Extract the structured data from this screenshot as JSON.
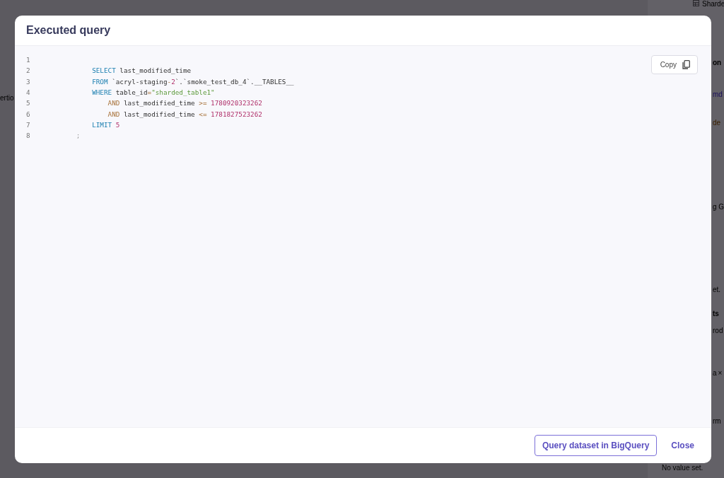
{
  "background_page": {
    "fragments": [
      {
        "kind": "table-link",
        "text": "Sharde"
      },
      {
        "kind": "heading",
        "text": "on"
      },
      {
        "kind": "link",
        "text": "md"
      },
      {
        "kind": "warning",
        "text": "de"
      },
      {
        "kind": "plain",
        "text": "g G"
      },
      {
        "kind": "muted",
        "text": "et."
      },
      {
        "kind": "heading",
        "text": "ts"
      },
      {
        "kind": "plain",
        "text": "rod"
      },
      {
        "kind": "tag",
        "text": "a",
        "close": "×"
      },
      {
        "kind": "plain",
        "text": "rm"
      },
      {
        "kind": "muted",
        "text": "No value set."
      },
      {
        "kind": "tab",
        "text": "ertio"
      }
    ]
  },
  "modal": {
    "title": "Executed query",
    "copy_button": "Copy",
    "code_lines": [
      {
        "number": "1"
      },
      {
        "number": "2",
        "tokens": [
          {
            "kind": "keyword",
            "text": "            SELECT"
          },
          {
            "kind": "plain",
            "text": " last_modified_time"
          }
        ]
      },
      {
        "number": "3",
        "tokens": [
          {
            "kind": "keyword",
            "text": "            FROM"
          },
          {
            "kind": "plain",
            "text": " `acryl-staging"
          },
          {
            "kind": "operator",
            "text": "-"
          },
          {
            "kind": "number",
            "text": "2"
          },
          {
            "kind": "plain",
            "text": "`.`smoke_test_db_4`.__TABLES__"
          }
        ]
      },
      {
        "number": "4",
        "tokens": [
          {
            "kind": "keyword",
            "text": "            WHERE"
          },
          {
            "kind": "plain",
            "text": " table_id"
          },
          {
            "kind": "operator",
            "text": "="
          },
          {
            "kind": "string",
            "text": "\"sharded_table1\""
          }
        ]
      },
      {
        "number": "5",
        "tokens": [
          {
            "kind": "operator",
            "text": "                AND"
          },
          {
            "kind": "plain",
            "text": " last_modified_time "
          },
          {
            "kind": "operator",
            "text": ">="
          },
          {
            "kind": "number",
            "text": " 1780920323262"
          }
        ]
      },
      {
        "number": "6",
        "tokens": [
          {
            "kind": "operator",
            "text": "                AND"
          },
          {
            "kind": "plain",
            "text": " last_modified_time "
          },
          {
            "kind": "operator",
            "text": "<="
          },
          {
            "kind": "number",
            "text": " 1781827523262"
          }
        ]
      },
      {
        "number": "7",
        "tokens": [
          {
            "kind": "keyword",
            "text": "            LIMIT"
          },
          {
            "kind": "number",
            "text": " 5"
          }
        ]
      },
      {
        "number": "8",
        "tokens": [
          {
            "kind": "punct",
            "text": "        ;"
          }
        ]
      }
    ],
    "buttons": [
      {
        "kind": "outline",
        "label": "Query dataset in BigQuery"
      },
      {
        "kind": "text",
        "label": "Close"
      }
    ]
  }
}
